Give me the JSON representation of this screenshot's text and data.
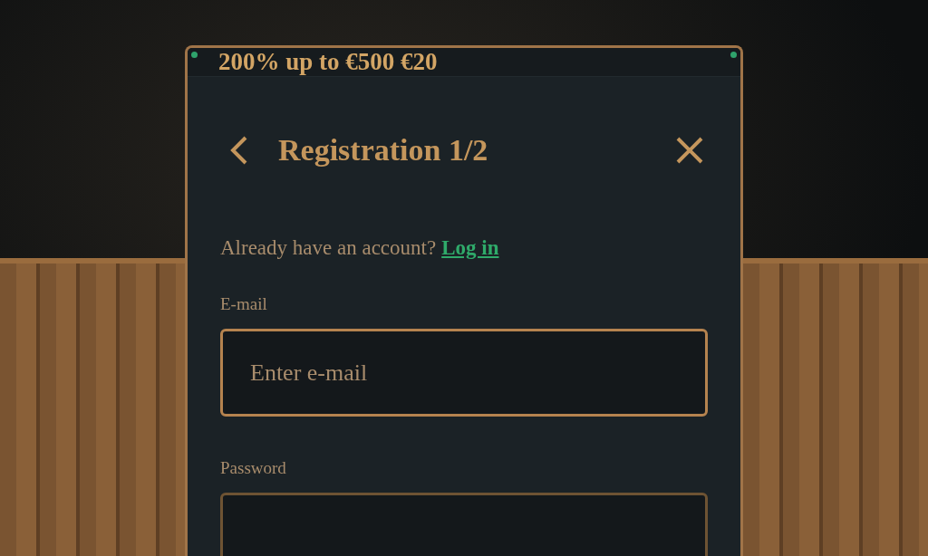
{
  "banner": {
    "text": "200% up to €500 €20"
  },
  "header": {
    "title": "Registration 1/2"
  },
  "login_prompt": {
    "text": "Already have an account?",
    "link": "Log in"
  },
  "fields": [
    {
      "label": "E-mail",
      "placeholder": "Enter e-mail",
      "focused": true
    },
    {
      "label": "Password",
      "focused": false
    }
  ]
}
